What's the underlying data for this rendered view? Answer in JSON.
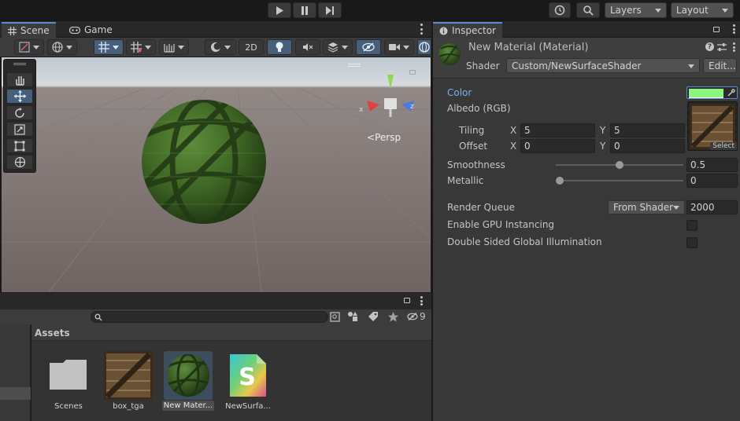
{
  "toolbar": {
    "play_icon": "play-icon",
    "pause_icon": "pause-icon",
    "step_icon": "step-icon",
    "layers_label": "Layers",
    "layout_label": "Layout"
  },
  "scene_tabs": {
    "scene": "Scene",
    "game": "Game"
  },
  "scene_toolbar": {
    "mode_2d": "2D"
  },
  "scene_view": {
    "persp_label": "Persp",
    "axis_x": "x",
    "axis_z": "z"
  },
  "inspector": {
    "tab_label": "Inspector",
    "material_name": "New Material (Material)",
    "shader_label": "Shader",
    "shader_value": "Custom/NewSurfaceShader",
    "edit_button": "Edit...",
    "color_label": "Color",
    "color_value": "#8cf57f",
    "albedo_label": "Albedo (RGB)",
    "tiling_label": "Tiling",
    "offset_label": "Offset",
    "x_label": "X",
    "y_label": "Y",
    "tiling_x": "5",
    "tiling_y": "5",
    "offset_x": "0",
    "offset_y": "0",
    "select_label": "Select",
    "smoothness_label": "Smoothness",
    "smoothness_value": "0.5",
    "metallic_label": "Metallic",
    "metallic_value": "0",
    "render_queue_label": "Render Queue",
    "render_queue_option": "From Shader",
    "render_queue_value": "2000",
    "gpu_instancing_label": "Enable GPU Instancing",
    "double_sided_label": "Double Sided Global Illumination"
  },
  "project": {
    "hidden_count": "9",
    "assets_header": "Assets",
    "assets": [
      {
        "name": "Scenes",
        "icon": "folder-icon"
      },
      {
        "name": "box_tga",
        "icon": "crate-texture-icon"
      },
      {
        "name": "New Mater...",
        "icon": "material-sphere-icon"
      },
      {
        "name": "NewSurfa...",
        "icon": "shader-icon"
      }
    ]
  },
  "colors": {
    "accent_blue": "#46607c",
    "color_label_blue": "#7bb0f0",
    "albedo_green": "#8cf57f"
  }
}
